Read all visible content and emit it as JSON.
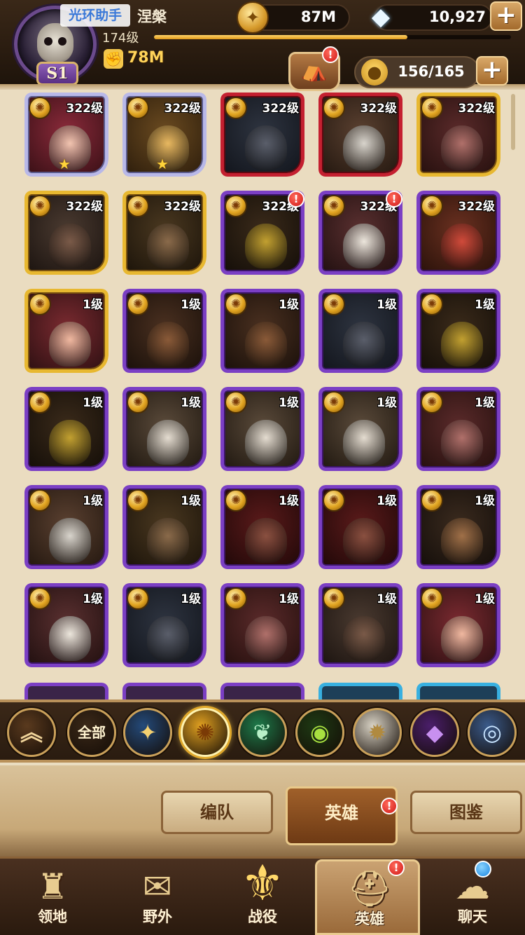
{
  "watermark": "光环助手",
  "player": {
    "name": "涅槃",
    "level": "174级",
    "xp_fraction": 0.71,
    "power": "78M",
    "season": "S1"
  },
  "resources": {
    "gold": "87M",
    "gems": "10,927",
    "plus": "+"
  },
  "roster": {
    "slots": "156/165",
    "camp_badge": "!"
  },
  "colors": {
    "frame_purple": "#7b3fc4",
    "frame_gold": "#e8b830",
    "frame_red": "#c42030",
    "frame_silver": "#b8b8e8",
    "notify_red": "#d01818"
  },
  "heroes": [
    {
      "level": "322级",
      "frame": "silver",
      "star": "★",
      "badge": "",
      "portrait": [
        "#8a2a3a",
        "#3a1016"
      ],
      "face": "#f2c4b0"
    },
    {
      "level": "322级",
      "frame": "silver",
      "star": "★",
      "badge": "",
      "portrait": [
        "#6a4a20",
        "#2e1e0c"
      ],
      "face": "#e8b860"
    },
    {
      "level": "322级",
      "frame": "red",
      "star": "",
      "badge": "",
      "portrait": [
        "#2e3440",
        "#12151c"
      ],
      "face": "#5a5e6a"
    },
    {
      "level": "322级",
      "frame": "red",
      "star": "",
      "badge": "",
      "portrait": [
        "#5a4030",
        "#241810"
      ],
      "face": "#d8d4cc"
    },
    {
      "level": "322级",
      "frame": "gold",
      "star": "",
      "badge": "",
      "portrait": [
        "#5a2a2a",
        "#26100e"
      ],
      "face": "#b0706a"
    },
    {
      "level": "322级",
      "frame": "gold",
      "star": "",
      "badge": "",
      "portrait": [
        "#4a3a30",
        "#1c1410"
      ],
      "face": "#7a5a48"
    },
    {
      "level": "322级",
      "frame": "gold",
      "star": "",
      "badge": "",
      "portrait": [
        "#4a3820",
        "#1c140a"
      ],
      "face": "#8a6a4a"
    },
    {
      "level": "322级",
      "frame": "purple",
      "star": "",
      "badge": "!",
      "portrait": [
        "#3a2a1a",
        "#140e08"
      ],
      "face": "#c2a030"
    },
    {
      "level": "322级",
      "frame": "purple",
      "star": "",
      "badge": "!",
      "portrait": [
        "#5a3030",
        "#221010"
      ],
      "face": "#ece6dc"
    },
    {
      "level": "322级",
      "frame": "purple",
      "star": "",
      "badge": "",
      "portrait": [
        "#6a3020",
        "#2a120a"
      ],
      "face": "#d04a3a"
    },
    {
      "level": "1级",
      "frame": "gold",
      "star": "",
      "badge": "",
      "portrait": [
        "#7a2a30",
        "#2e1012"
      ],
      "face": "#f0b8a0"
    },
    {
      "level": "1级",
      "frame": "purple",
      "star": "",
      "badge": "",
      "portrait": [
        "#4a3020",
        "#1a100a"
      ],
      "face": "#8a5a38"
    },
    {
      "level": "1级",
      "frame": "purple",
      "star": "",
      "badge": "",
      "portrait": [
        "#4a3020",
        "#1a100a"
      ],
      "face": "#8a5a38"
    },
    {
      "level": "1级",
      "frame": "purple",
      "star": "",
      "badge": "",
      "portrait": [
        "#2e3440",
        "#12151c"
      ],
      "face": "#5a5e6a"
    },
    {
      "level": "1级",
      "frame": "purple",
      "star": "",
      "badge": "",
      "portrait": [
        "#3a2a1a",
        "#140e08"
      ],
      "face": "#c2a030"
    },
    {
      "level": "1级",
      "frame": "purple",
      "star": "",
      "badge": "",
      "portrait": [
        "#3a2a1a",
        "#140e08"
      ],
      "face": "#c2a030"
    },
    {
      "level": "1级",
      "frame": "purple",
      "star": "",
      "badge": "",
      "portrait": [
        "#5a4a3a",
        "#201810"
      ],
      "face": "#e4dcd0"
    },
    {
      "level": "1级",
      "frame": "purple",
      "star": "",
      "badge": "",
      "portrait": [
        "#5a4a3a",
        "#201810"
      ],
      "face": "#e4dcd0"
    },
    {
      "level": "1级",
      "frame": "purple",
      "star": "",
      "badge": "",
      "portrait": [
        "#5a4a3a",
        "#201810"
      ],
      "face": "#e4dcd0"
    },
    {
      "level": "1级",
      "frame": "purple",
      "star": "",
      "badge": "",
      "portrait": [
        "#5a2a2a",
        "#26100e"
      ],
      "face": "#b0706a"
    },
    {
      "level": "1级",
      "frame": "purple",
      "star": "",
      "badge": "",
      "portrait": [
        "#5a4030",
        "#241810"
      ],
      "face": "#d8d4cc"
    },
    {
      "level": "1级",
      "frame": "purple",
      "star": "",
      "badge": "",
      "portrait": [
        "#4a3820",
        "#1c140a"
      ],
      "face": "#8a6a4a"
    },
    {
      "level": "1级",
      "frame": "purple",
      "star": "",
      "badge": "",
      "portrait": [
        "#5a1a1a",
        "#200808"
      ],
      "face": "#8a5040"
    },
    {
      "level": "1级",
      "frame": "purple",
      "star": "",
      "badge": "",
      "portrait": [
        "#5a1a1a",
        "#200808"
      ],
      "face": "#8a5040"
    },
    {
      "level": "1级",
      "frame": "purple",
      "star": "",
      "badge": "",
      "portrait": [
        "#3a2a1e",
        "#140e0a"
      ],
      "face": "#a07048"
    },
    {
      "level": "1级",
      "frame": "purple",
      "star": "",
      "badge": "",
      "portrait": [
        "#5a3030",
        "#221010"
      ],
      "face": "#ece6dc"
    },
    {
      "level": "1级",
      "frame": "purple",
      "star": "",
      "badge": "",
      "portrait": [
        "#2e3440",
        "#12151c"
      ],
      "face": "#5a5e6a"
    },
    {
      "level": "1级",
      "frame": "purple",
      "star": "",
      "badge": "",
      "portrait": [
        "#5a2a2a",
        "#26100e"
      ],
      "face": "#b0706a"
    },
    {
      "level": "1级",
      "frame": "purple",
      "star": "",
      "badge": "",
      "portrait": [
        "#4a3a30",
        "#1c1410"
      ],
      "face": "#7a5a48"
    },
    {
      "level": "1级",
      "frame": "purple",
      "star": "",
      "badge": "",
      "portrait": [
        "#7a2a30",
        "#2e1012"
      ],
      "face": "#f0b8a0"
    }
  ],
  "filters": [
    {
      "label": "",
      "icon": "double-chevron-up-icon",
      "glyph": "︽",
      "bg": "#5a3a1e",
      "color": "#f0d49a"
    },
    {
      "label": "全部",
      "icon": "all-factions-icon",
      "glyph": "",
      "bg": "#3a2818",
      "color": "#fff3d0"
    },
    {
      "label": "",
      "icon": "lightbearer-star-icon",
      "glyph": "✦",
      "bg": "#244a7a",
      "color": "#f4d070"
    },
    {
      "label": "",
      "icon": "mauler-sun-icon",
      "glyph": "✺",
      "bg": "#e0a020",
      "color": "#7a3a06"
    },
    {
      "label": "",
      "icon": "wilder-leaf-icon",
      "glyph": "❦",
      "bg": "#1e7a4a",
      "color": "#b8f0c8"
    },
    {
      "label": "",
      "icon": "graveborn-eye-icon",
      "glyph": "◉",
      "bg": "#1e3a14",
      "color": "#a8e040"
    },
    {
      "label": "",
      "icon": "celestial-burst-icon",
      "glyph": "✹",
      "bg": "#d8d2c4",
      "color": "#b08a40"
    },
    {
      "label": "",
      "icon": "hypogean-demon-icon",
      "glyph": "◆",
      "bg": "#4a1e6a",
      "color": "#c890f0"
    },
    {
      "label": "",
      "icon": "dimensional-shield-icon",
      "glyph": "◎",
      "bg": "#3a5a8a",
      "color": "#c8e4ff"
    }
  ],
  "subtabs": {
    "formation": "编队",
    "heroes": "英雄",
    "codex": "图鉴",
    "heroes_badge": "!"
  },
  "nav": {
    "territory": "领地",
    "wild": "野外",
    "campaign": "战役",
    "heroes": "英雄",
    "chat": "聊天",
    "heroes_badge": "!"
  }
}
